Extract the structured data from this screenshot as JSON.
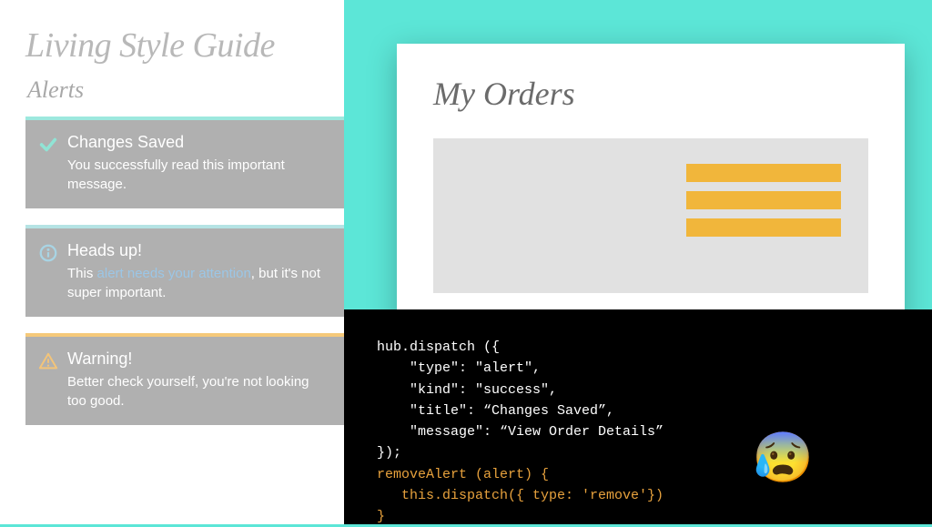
{
  "styleguide": {
    "title": "Living Style Guide",
    "subtitle": "Alerts",
    "alerts": [
      {
        "icon": "check-icon",
        "title": "Changes Saved",
        "message": "You successfully read this important message."
      },
      {
        "icon": "info-icon",
        "title": "Heads up!",
        "message_pre": "This ",
        "message_highlight": "alert needs your attention",
        "message_post": ", but it's not super important."
      },
      {
        "icon": "warning-icon",
        "title": "Warning!",
        "message": "Better check yourself, you're not looking too good."
      }
    ]
  },
  "orders": {
    "title": "My Orders"
  },
  "code": {
    "lines": [
      "hub.dispatch ({",
      "    \"type\": \"alert\",",
      "    \"kind\": \"success\",",
      "    \"title\": “Changes Saved”,",
      "    \"message\": “View Order Details”",
      "});"
    ],
    "orange_lines": [
      "removeAlert (alert) {",
      "   this.dispatch({ type: 'remove'})",
      "}"
    ],
    "emoji": "😰"
  }
}
